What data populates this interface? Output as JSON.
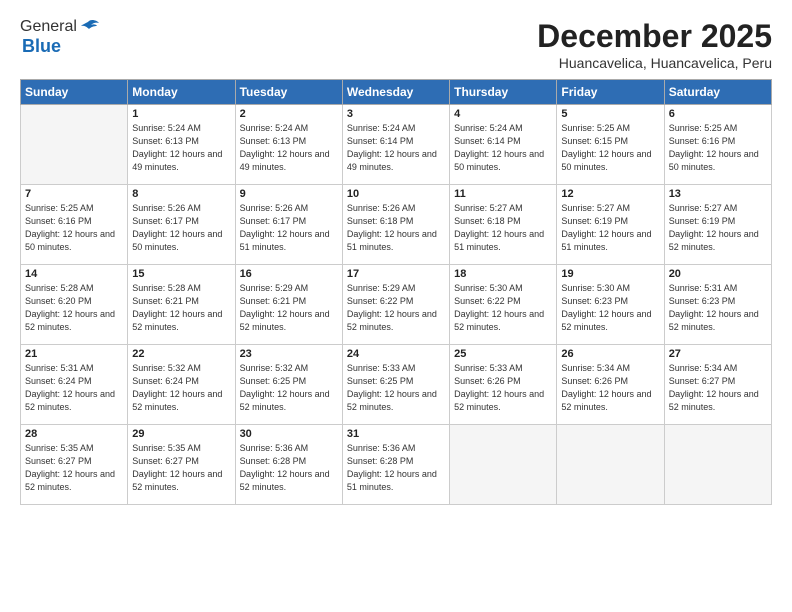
{
  "logo": {
    "general": "General",
    "blue": "Blue"
  },
  "header": {
    "month": "December 2025",
    "location": "Huancavelica, Huancavelica, Peru"
  },
  "weekdays": [
    "Sunday",
    "Monday",
    "Tuesday",
    "Wednesday",
    "Thursday",
    "Friday",
    "Saturday"
  ],
  "weeks": [
    [
      {
        "day": "",
        "sunrise": "",
        "sunset": "",
        "daylight": ""
      },
      {
        "day": "1",
        "sunrise": "Sunrise: 5:24 AM",
        "sunset": "Sunset: 6:13 PM",
        "daylight": "Daylight: 12 hours and 49 minutes."
      },
      {
        "day": "2",
        "sunrise": "Sunrise: 5:24 AM",
        "sunset": "Sunset: 6:13 PM",
        "daylight": "Daylight: 12 hours and 49 minutes."
      },
      {
        "day": "3",
        "sunrise": "Sunrise: 5:24 AM",
        "sunset": "Sunset: 6:14 PM",
        "daylight": "Daylight: 12 hours and 49 minutes."
      },
      {
        "day": "4",
        "sunrise": "Sunrise: 5:24 AM",
        "sunset": "Sunset: 6:14 PM",
        "daylight": "Daylight: 12 hours and 50 minutes."
      },
      {
        "day": "5",
        "sunrise": "Sunrise: 5:25 AM",
        "sunset": "Sunset: 6:15 PM",
        "daylight": "Daylight: 12 hours and 50 minutes."
      },
      {
        "day": "6",
        "sunrise": "Sunrise: 5:25 AM",
        "sunset": "Sunset: 6:16 PM",
        "daylight": "Daylight: 12 hours and 50 minutes."
      }
    ],
    [
      {
        "day": "7",
        "sunrise": "Sunrise: 5:25 AM",
        "sunset": "Sunset: 6:16 PM",
        "daylight": "Daylight: 12 hours and 50 minutes."
      },
      {
        "day": "8",
        "sunrise": "Sunrise: 5:26 AM",
        "sunset": "Sunset: 6:17 PM",
        "daylight": "Daylight: 12 hours and 50 minutes."
      },
      {
        "day": "9",
        "sunrise": "Sunrise: 5:26 AM",
        "sunset": "Sunset: 6:17 PM",
        "daylight": "Daylight: 12 hours and 51 minutes."
      },
      {
        "day": "10",
        "sunrise": "Sunrise: 5:26 AM",
        "sunset": "Sunset: 6:18 PM",
        "daylight": "Daylight: 12 hours and 51 minutes."
      },
      {
        "day": "11",
        "sunrise": "Sunrise: 5:27 AM",
        "sunset": "Sunset: 6:18 PM",
        "daylight": "Daylight: 12 hours and 51 minutes."
      },
      {
        "day": "12",
        "sunrise": "Sunrise: 5:27 AM",
        "sunset": "Sunset: 6:19 PM",
        "daylight": "Daylight: 12 hours and 51 minutes."
      },
      {
        "day": "13",
        "sunrise": "Sunrise: 5:27 AM",
        "sunset": "Sunset: 6:19 PM",
        "daylight": "Daylight: 12 hours and 52 minutes."
      }
    ],
    [
      {
        "day": "14",
        "sunrise": "Sunrise: 5:28 AM",
        "sunset": "Sunset: 6:20 PM",
        "daylight": "Daylight: 12 hours and 52 minutes."
      },
      {
        "day": "15",
        "sunrise": "Sunrise: 5:28 AM",
        "sunset": "Sunset: 6:21 PM",
        "daylight": "Daylight: 12 hours and 52 minutes."
      },
      {
        "day": "16",
        "sunrise": "Sunrise: 5:29 AM",
        "sunset": "Sunset: 6:21 PM",
        "daylight": "Daylight: 12 hours and 52 minutes."
      },
      {
        "day": "17",
        "sunrise": "Sunrise: 5:29 AM",
        "sunset": "Sunset: 6:22 PM",
        "daylight": "Daylight: 12 hours and 52 minutes."
      },
      {
        "day": "18",
        "sunrise": "Sunrise: 5:30 AM",
        "sunset": "Sunset: 6:22 PM",
        "daylight": "Daylight: 12 hours and 52 minutes."
      },
      {
        "day": "19",
        "sunrise": "Sunrise: 5:30 AM",
        "sunset": "Sunset: 6:23 PM",
        "daylight": "Daylight: 12 hours and 52 minutes."
      },
      {
        "day": "20",
        "sunrise": "Sunrise: 5:31 AM",
        "sunset": "Sunset: 6:23 PM",
        "daylight": "Daylight: 12 hours and 52 minutes."
      }
    ],
    [
      {
        "day": "21",
        "sunrise": "Sunrise: 5:31 AM",
        "sunset": "Sunset: 6:24 PM",
        "daylight": "Daylight: 12 hours and 52 minutes."
      },
      {
        "day": "22",
        "sunrise": "Sunrise: 5:32 AM",
        "sunset": "Sunset: 6:24 PM",
        "daylight": "Daylight: 12 hours and 52 minutes."
      },
      {
        "day": "23",
        "sunrise": "Sunrise: 5:32 AM",
        "sunset": "Sunset: 6:25 PM",
        "daylight": "Daylight: 12 hours and 52 minutes."
      },
      {
        "day": "24",
        "sunrise": "Sunrise: 5:33 AM",
        "sunset": "Sunset: 6:25 PM",
        "daylight": "Daylight: 12 hours and 52 minutes."
      },
      {
        "day": "25",
        "sunrise": "Sunrise: 5:33 AM",
        "sunset": "Sunset: 6:26 PM",
        "daylight": "Daylight: 12 hours and 52 minutes."
      },
      {
        "day": "26",
        "sunrise": "Sunrise: 5:34 AM",
        "sunset": "Sunset: 6:26 PM",
        "daylight": "Daylight: 12 hours and 52 minutes."
      },
      {
        "day": "27",
        "sunrise": "Sunrise: 5:34 AM",
        "sunset": "Sunset: 6:27 PM",
        "daylight": "Daylight: 12 hours and 52 minutes."
      }
    ],
    [
      {
        "day": "28",
        "sunrise": "Sunrise: 5:35 AM",
        "sunset": "Sunset: 6:27 PM",
        "daylight": "Daylight: 12 hours and 52 minutes."
      },
      {
        "day": "29",
        "sunrise": "Sunrise: 5:35 AM",
        "sunset": "Sunset: 6:27 PM",
        "daylight": "Daylight: 12 hours and 52 minutes."
      },
      {
        "day": "30",
        "sunrise": "Sunrise: 5:36 AM",
        "sunset": "Sunset: 6:28 PM",
        "daylight": "Daylight: 12 hours and 52 minutes."
      },
      {
        "day": "31",
        "sunrise": "Sunrise: 5:36 AM",
        "sunset": "Sunset: 6:28 PM",
        "daylight": "Daylight: 12 hours and 51 minutes."
      },
      {
        "day": "",
        "sunrise": "",
        "sunset": "",
        "daylight": ""
      },
      {
        "day": "",
        "sunrise": "",
        "sunset": "",
        "daylight": ""
      },
      {
        "day": "",
        "sunrise": "",
        "sunset": "",
        "daylight": ""
      }
    ]
  ]
}
